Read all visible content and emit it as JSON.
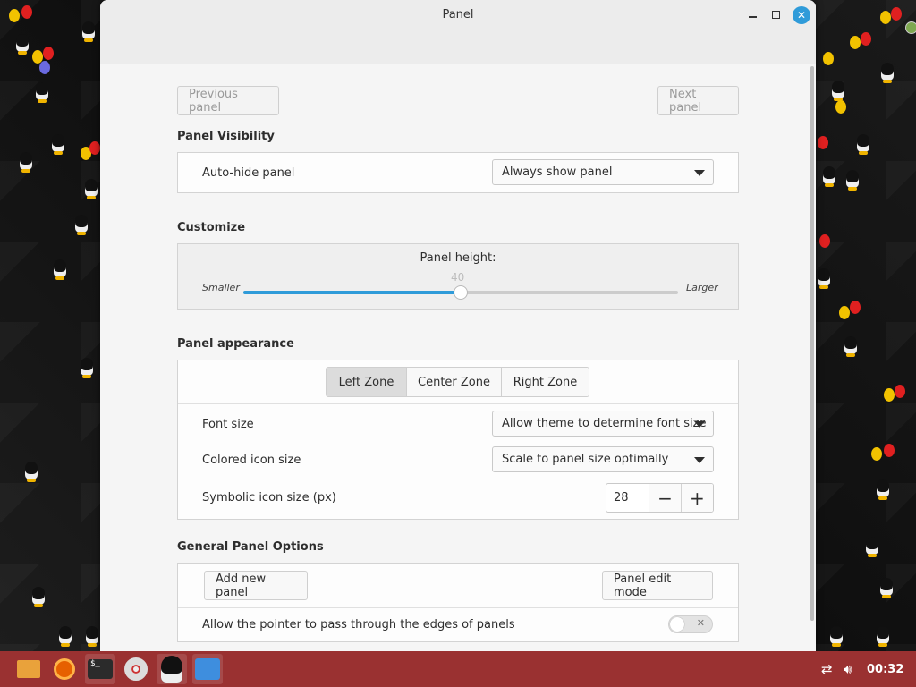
{
  "window": {
    "title": "Panel"
  },
  "nav": {
    "previous": "Previous panel",
    "next": "Next panel"
  },
  "visibility": {
    "section_title": "Panel Visibility",
    "autohide_label": "Auto-hide panel",
    "autohide_value": "Always show panel"
  },
  "customize": {
    "section_title": "Customize",
    "height_label": "Panel height:",
    "height_value": "40",
    "height_fraction": 0.5,
    "min_label": "Smaller",
    "max_label": "Larger"
  },
  "appearance": {
    "section_title": "Panel appearance",
    "zones": [
      "Left Zone",
      "Center Zone",
      "Right Zone"
    ],
    "active_zone": "Left Zone",
    "font_size_label": "Font size",
    "font_size_value": "Allow theme to determine font size",
    "colored_icon_label": "Colored icon size",
    "colored_icon_value": "Scale to panel size optimally",
    "symbolic_icon_label": "Symbolic icon size (px)",
    "symbolic_icon_value": "28"
  },
  "general": {
    "section_title": "General Panel Options",
    "add_panel": "Add new panel",
    "edit_mode": "Panel edit mode",
    "pass_through_label": "Allow the pointer to pass through the edges of panels",
    "pass_through_enabled": false
  },
  "taskbar": {
    "apps": [
      "folder-icon",
      "firefox-icon",
      "terminal-icon",
      "disc-icon",
      "tux-icon",
      "panel-settings-icon"
    ],
    "terminal_glyph": "$_",
    "clock": "00:32",
    "accent": "#9a3131"
  },
  "colors": {
    "accent": "#2f9bd9",
    "window_bg": "#f5f5f5"
  }
}
